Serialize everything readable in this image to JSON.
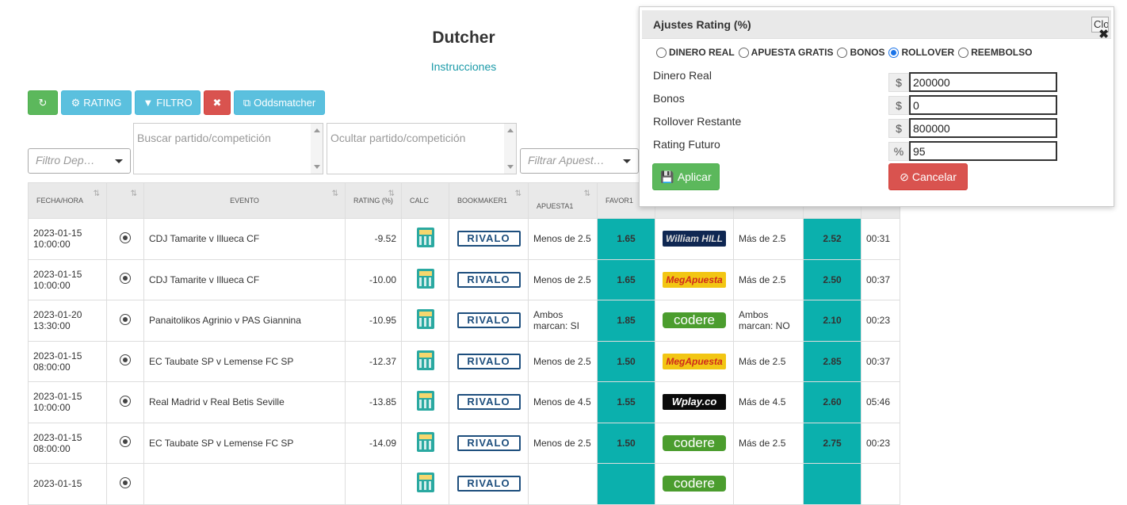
{
  "page": {
    "title": "Dutcher",
    "instructions": "Instrucciones"
  },
  "toolbar": {
    "refresh_icon": "refresh-icon",
    "rating_label": "RATING",
    "filter_label": "FILTRO",
    "clear_icon": "close-icon",
    "oddsmatcher_label": "Oddsmatcher"
  },
  "filters": {
    "deporte_placeholder": "Filtro Dep…",
    "buscar_placeholder": "Buscar partido/competición",
    "ocultar_placeholder": "Ocultar partido/competición",
    "apuesta_placeholder": "Filtrar Apuest…"
  },
  "table": {
    "headers": [
      "FECHA/HORA",
      "",
      "EVENTO",
      "RATING (%)",
      "CALC",
      "BOOKMAKER1",
      "APUESTA1",
      "FAVOR1",
      "",
      "",
      "",
      ""
    ],
    "rows": [
      {
        "date": "2023-01-15",
        "time": "10:00:00",
        "event": "CDJ Tamarite v Illueca CF",
        "rating": "-9.52",
        "bookmaker1": "RIVALO",
        "bet1": "Menos de 2.5",
        "favor1": "1.65",
        "bookmaker2": "William HILL",
        "bet2": "Más de 2.5",
        "favor2": "2.52",
        "time_left": "00:31"
      },
      {
        "date": "2023-01-15",
        "time": "10:00:00",
        "event": "CDJ Tamarite v Illueca CF",
        "rating": "-10.00",
        "bookmaker1": "RIVALO",
        "bet1": "Menos de 2.5",
        "favor1": "1.65",
        "bookmaker2": "MegApuesta",
        "bet2": "Más de 2.5",
        "favor2": "2.50",
        "time_left": "00:37"
      },
      {
        "date": "2023-01-20",
        "time": "13:30:00",
        "event": "Panaitolikos Agrinio v PAS Giannina",
        "rating": "-10.95",
        "bookmaker1": "RIVALO",
        "bet1": "Ambos marcan: SI",
        "favor1": "1.85",
        "bookmaker2": "codere",
        "bet2": "Ambos marcan: NO",
        "favor2": "2.10",
        "time_left": "00:23"
      },
      {
        "date": "2023-01-15",
        "time": "08:00:00",
        "event": "EC Taubate SP v Lemense FC SP",
        "rating": "-12.37",
        "bookmaker1": "RIVALO",
        "bet1": "Menos de 2.5",
        "favor1": "1.50",
        "bookmaker2": "MegApuesta",
        "bet2": "Más de 2.5",
        "favor2": "2.85",
        "time_left": "00:37"
      },
      {
        "date": "2023-01-15",
        "time": "10:00:00",
        "event": "Real Madrid v Real Betis Seville",
        "rating": "-13.85",
        "bookmaker1": "RIVALO",
        "bet1": "Menos de 4.5",
        "favor1": "1.55",
        "bookmaker2": "Wplay.co",
        "bet2": "Más de 4.5",
        "favor2": "2.60",
        "time_left": "05:46"
      },
      {
        "date": "2023-01-15",
        "time": "08:00:00",
        "event": "EC Taubate SP v Lemense FC SP",
        "rating": "-14.09",
        "bookmaker1": "RIVALO",
        "bet1": "Menos de 2.5",
        "favor1": "1.50",
        "bookmaker2": "codere",
        "bet2": "Más de 2.5",
        "favor2": "2.75",
        "time_left": "00:23"
      },
      {
        "date": "2023-01-15",
        "time": "",
        "event": "",
        "rating": "",
        "bookmaker1": "RIVALO",
        "bet1": "",
        "favor1": "",
        "bookmaker2": "codere",
        "bet2": "",
        "favor2": "",
        "time_left": ""
      }
    ]
  },
  "modal": {
    "title": "Ajustes Rating (%)",
    "close_label": "Close",
    "radios": [
      {
        "label": "DINERO REAL",
        "checked": false
      },
      {
        "label": "APUESTA GRATIS",
        "checked": false
      },
      {
        "label": "BONOS",
        "checked": false
      },
      {
        "label": "ROLLOVER",
        "checked": true
      },
      {
        "label": "REEMBOLSO",
        "checked": false
      }
    ],
    "fields": [
      {
        "label": "Dinero Real",
        "addon": "$",
        "value": "200000"
      },
      {
        "label": "Bonos",
        "addon": "$",
        "value": "0"
      },
      {
        "label": "Rollover Restante",
        "addon": "$",
        "value": "800000"
      },
      {
        "label": "Rating Futuro",
        "addon": "%",
        "value": "95"
      }
    ],
    "apply_label": "Aplicar",
    "cancel_label": "Cancelar"
  },
  "colors": {
    "teal": "#0bb0ad",
    "green": "#5cb85c",
    "info": "#5bc0de",
    "red": "#d9534f"
  }
}
